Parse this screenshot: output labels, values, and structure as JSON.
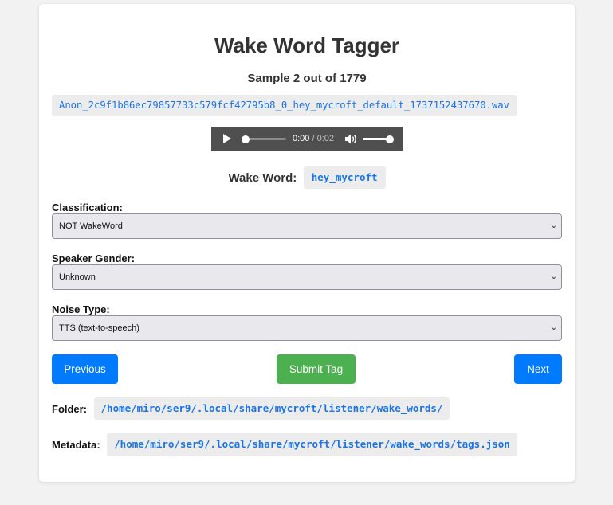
{
  "header": {
    "title": "Wake Word Tagger",
    "sample_progress": "Sample 2 out of 1779",
    "sample_index": 2,
    "sample_total": 1779
  },
  "file": {
    "name": "Anon_2c9f1b86ec79857733c579fcf42795b8_0_hey_mycroft_default_1737152437670.wav"
  },
  "audio_player": {
    "current_time": "0:00",
    "separator": " / ",
    "duration": "0:02",
    "progress": 0,
    "volume": 1,
    "play_icon": "play-icon",
    "volume_icon": "volume-icon"
  },
  "wake_word": {
    "label": "Wake Word:",
    "value": "hey_mycroft"
  },
  "classification": {
    "label": "Classification:",
    "selected": "NOT WakeWord"
  },
  "speaker_gender": {
    "label": "Speaker Gender:",
    "selected": "Unknown"
  },
  "noise_type": {
    "label": "Noise Type:",
    "selected": "TTS (text-to-speech)"
  },
  "buttons": {
    "previous": "Previous",
    "submit": "Submit Tag",
    "next": "Next"
  },
  "paths": {
    "folder_label": "Folder:",
    "folder_value": "/home/miro/ser9/.local/share/mycroft/listener/wake_words/",
    "metadata_label": "Metadata:",
    "metadata_value": "/home/miro/ser9/.local/share/mycroft/listener/wake_words/tags.json"
  },
  "colors": {
    "primary": "#007bff",
    "success": "#4caf50",
    "code_text": "#1a73e8",
    "page_bg": "#f2f2f2"
  }
}
